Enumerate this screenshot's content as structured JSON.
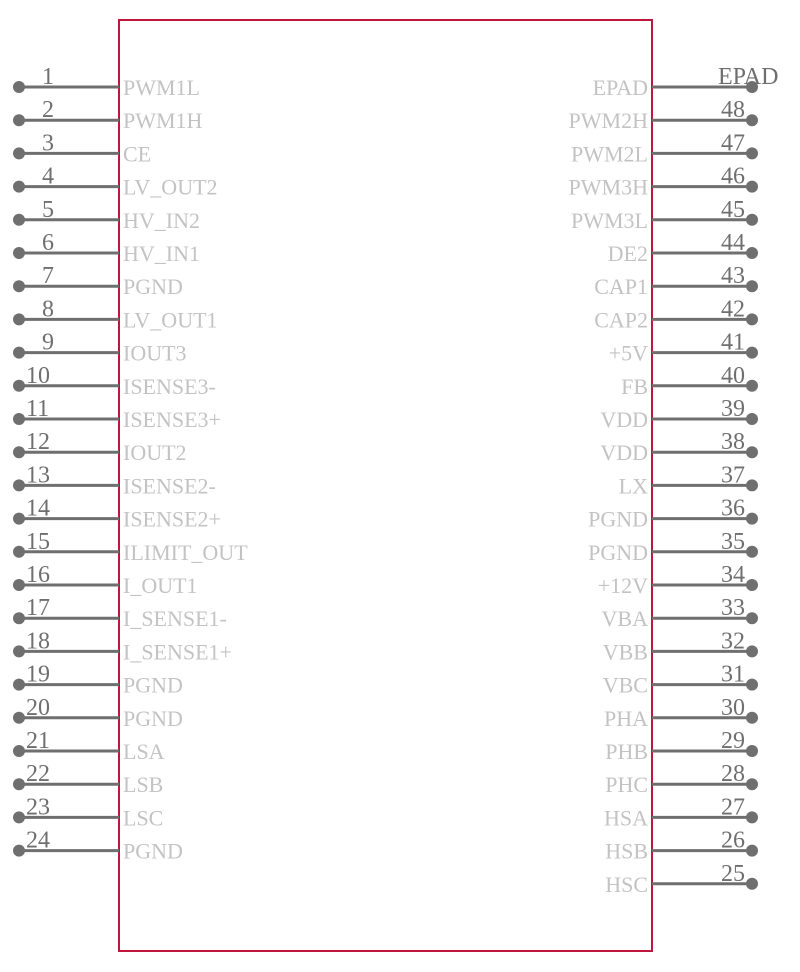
{
  "component": {
    "body_color": "#c0163e",
    "pin_color": "#6f6f6f",
    "label_color": "#c3c3c3"
  },
  "pins_left": [
    {
      "number": "1",
      "name": "PWM1L"
    },
    {
      "number": "2",
      "name": "PWM1H"
    },
    {
      "number": "3",
      "name": "CE"
    },
    {
      "number": "4",
      "name": "LV_OUT2"
    },
    {
      "number": "5",
      "name": "HV_IN2"
    },
    {
      "number": "6",
      "name": "HV_IN1"
    },
    {
      "number": "7",
      "name": "PGND"
    },
    {
      "number": "8",
      "name": "LV_OUT1"
    },
    {
      "number": "9",
      "name": "IOUT3"
    },
    {
      "number": "10",
      "name": "ISENSE3-"
    },
    {
      "number": "11",
      "name": "ISENSE3+"
    },
    {
      "number": "12",
      "name": "IOUT2"
    },
    {
      "number": "13",
      "name": "ISENSE2-"
    },
    {
      "number": "14",
      "name": "ISENSE2+"
    },
    {
      "number": "15",
      "name": "ILIMIT_OUT"
    },
    {
      "number": "16",
      "name": "I_OUT1"
    },
    {
      "number": "17",
      "name": "I_SENSE1-"
    },
    {
      "number": "18",
      "name": "I_SENSE1+"
    },
    {
      "number": "19",
      "name": "PGND"
    },
    {
      "number": "20",
      "name": "PGND"
    },
    {
      "number": "21",
      "name": "LSA"
    },
    {
      "number": "22",
      "name": "LSB"
    },
    {
      "number": "23",
      "name": "LSC"
    },
    {
      "number": "24",
      "name": "PGND"
    }
  ],
  "pins_right": [
    {
      "number": "EPAD",
      "name": "EPAD"
    },
    {
      "number": "48",
      "name": "PWM2H"
    },
    {
      "number": "47",
      "name": "PWM2L"
    },
    {
      "number": "46",
      "name": "PWM3H"
    },
    {
      "number": "45",
      "name": "PWM3L"
    },
    {
      "number": "44",
      "name": "DE2"
    },
    {
      "number": "43",
      "name": "CAP1"
    },
    {
      "number": "42",
      "name": "CAP2"
    },
    {
      "number": "41",
      "name": "+5V"
    },
    {
      "number": "40",
      "name": "FB"
    },
    {
      "number": "39",
      "name": "VDD"
    },
    {
      "number": "38",
      "name": "VDD"
    },
    {
      "number": "37",
      "name": "LX"
    },
    {
      "number": "36",
      "name": "PGND"
    },
    {
      "number": "35",
      "name": "PGND"
    },
    {
      "number": "34",
      "name": "+12V"
    },
    {
      "number": "33",
      "name": "VBA"
    },
    {
      "number": "32",
      "name": "VBB"
    },
    {
      "number": "31",
      "name": "VBC"
    },
    {
      "number": "30",
      "name": "PHA"
    },
    {
      "number": "29",
      "name": "PHB"
    },
    {
      "number": "28",
      "name": "PHC"
    },
    {
      "number": "27",
      "name": "HSA"
    },
    {
      "number": "26",
      "name": "HSB"
    },
    {
      "number": "25",
      "name": "HSC"
    }
  ]
}
